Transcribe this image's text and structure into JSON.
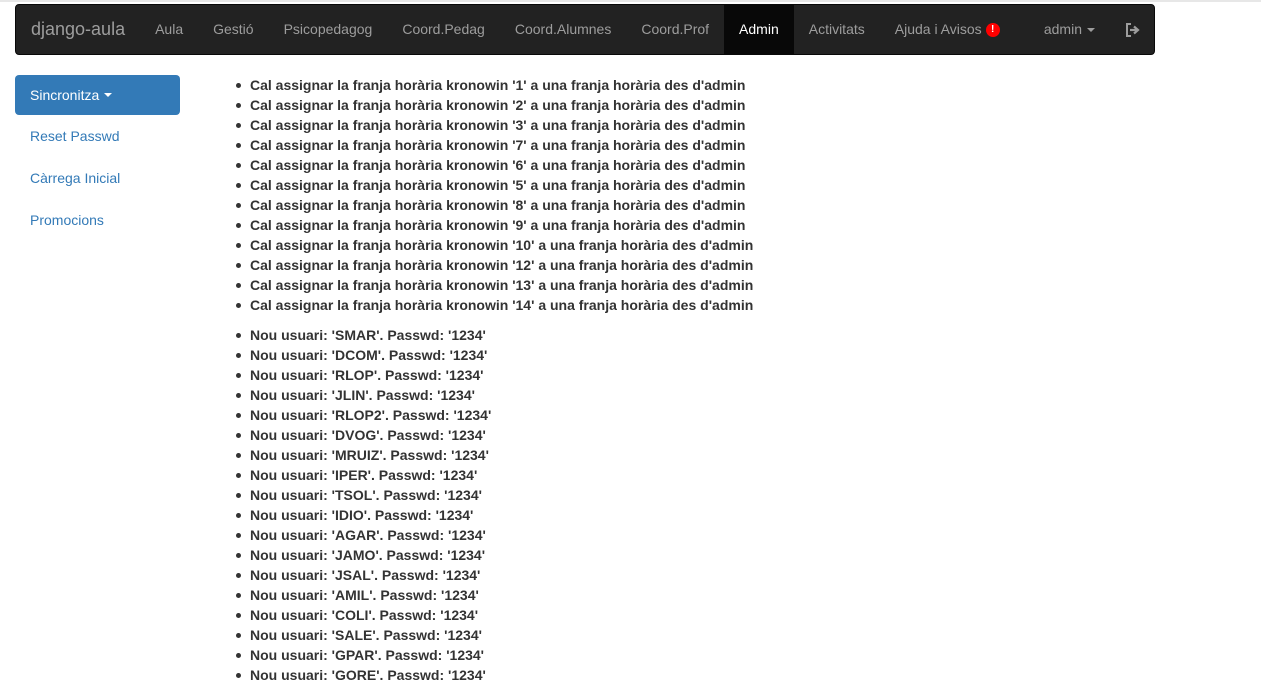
{
  "navbar": {
    "brand": "django-aula",
    "items": [
      "Aula",
      "Gestió",
      "Psicopedagog",
      "Coord.Pedag",
      "Coord.Alumnes",
      "Coord.Prof",
      "Admin",
      "Activitats",
      "Ajuda i Avisos"
    ],
    "active": "Admin",
    "alert_badge": "!",
    "user": "admin"
  },
  "sidebar": {
    "sync_label": "Sincronitza",
    "links": [
      "Reset Passwd",
      "Càrrega Inicial",
      "Promocions"
    ]
  },
  "franja_messages": [
    "Cal assignar la franja horària kronowin '1' a una franja horària des d'admin",
    "Cal assignar la franja horària kronowin '2' a una franja horària des d'admin",
    "Cal assignar la franja horària kronowin '3' a una franja horària des d'admin",
    "Cal assignar la franja horària kronowin '7' a una franja horària des d'admin",
    "Cal assignar la franja horària kronowin '6' a una franja horària des d'admin",
    "Cal assignar la franja horària kronowin '5' a una franja horària des d'admin",
    "Cal assignar la franja horària kronowin '8' a una franja horària des d'admin",
    "Cal assignar la franja horària kronowin '9' a una franja horària des d'admin",
    "Cal assignar la franja horària kronowin '10' a una franja horària des d'admin",
    "Cal assignar la franja horària kronowin '12' a una franja horària des d'admin",
    "Cal assignar la franja horària kronowin '13' a una franja horària des d'admin",
    "Cal assignar la franja horària kronowin '14' a una franja horària des d'admin"
  ],
  "user_messages": [
    "Nou usuari: 'SMAR'. Passwd: '1234'",
    "Nou usuari: 'DCOM'. Passwd: '1234'",
    "Nou usuari: 'RLOP'. Passwd: '1234'",
    "Nou usuari: 'JLIN'. Passwd: '1234'",
    "Nou usuari: 'RLOP2'. Passwd: '1234'",
    "Nou usuari: 'DVOG'. Passwd: '1234'",
    "Nou usuari: 'MRUIZ'. Passwd: '1234'",
    "Nou usuari: 'IPER'. Passwd: '1234'",
    "Nou usuari: 'TSOL'. Passwd: '1234'",
    "Nou usuari: 'IDIO'. Passwd: '1234'",
    "Nou usuari: 'AGAR'. Passwd: '1234'",
    "Nou usuari: 'JAMO'. Passwd: '1234'",
    "Nou usuari: 'JSAL'. Passwd: '1234'",
    "Nou usuari: 'AMIL'. Passwd: '1234'",
    "Nou usuari: 'COLI'. Passwd: '1234'",
    "Nou usuari: 'SALE'. Passwd: '1234'",
    "Nou usuari: 'GPAR'. Passwd: '1234'",
    "Nou usuari: 'GORE'. Passwd: '1234'"
  ],
  "icons": {
    "alert": "exclamation-circle-icon",
    "user_caret": "chevron-down-icon",
    "logout": "logout-icon"
  },
  "colors": {
    "navbar_bg": "#222222",
    "active_bg": "#080808",
    "primary": "#337ab7",
    "alert": "#ff0000"
  }
}
